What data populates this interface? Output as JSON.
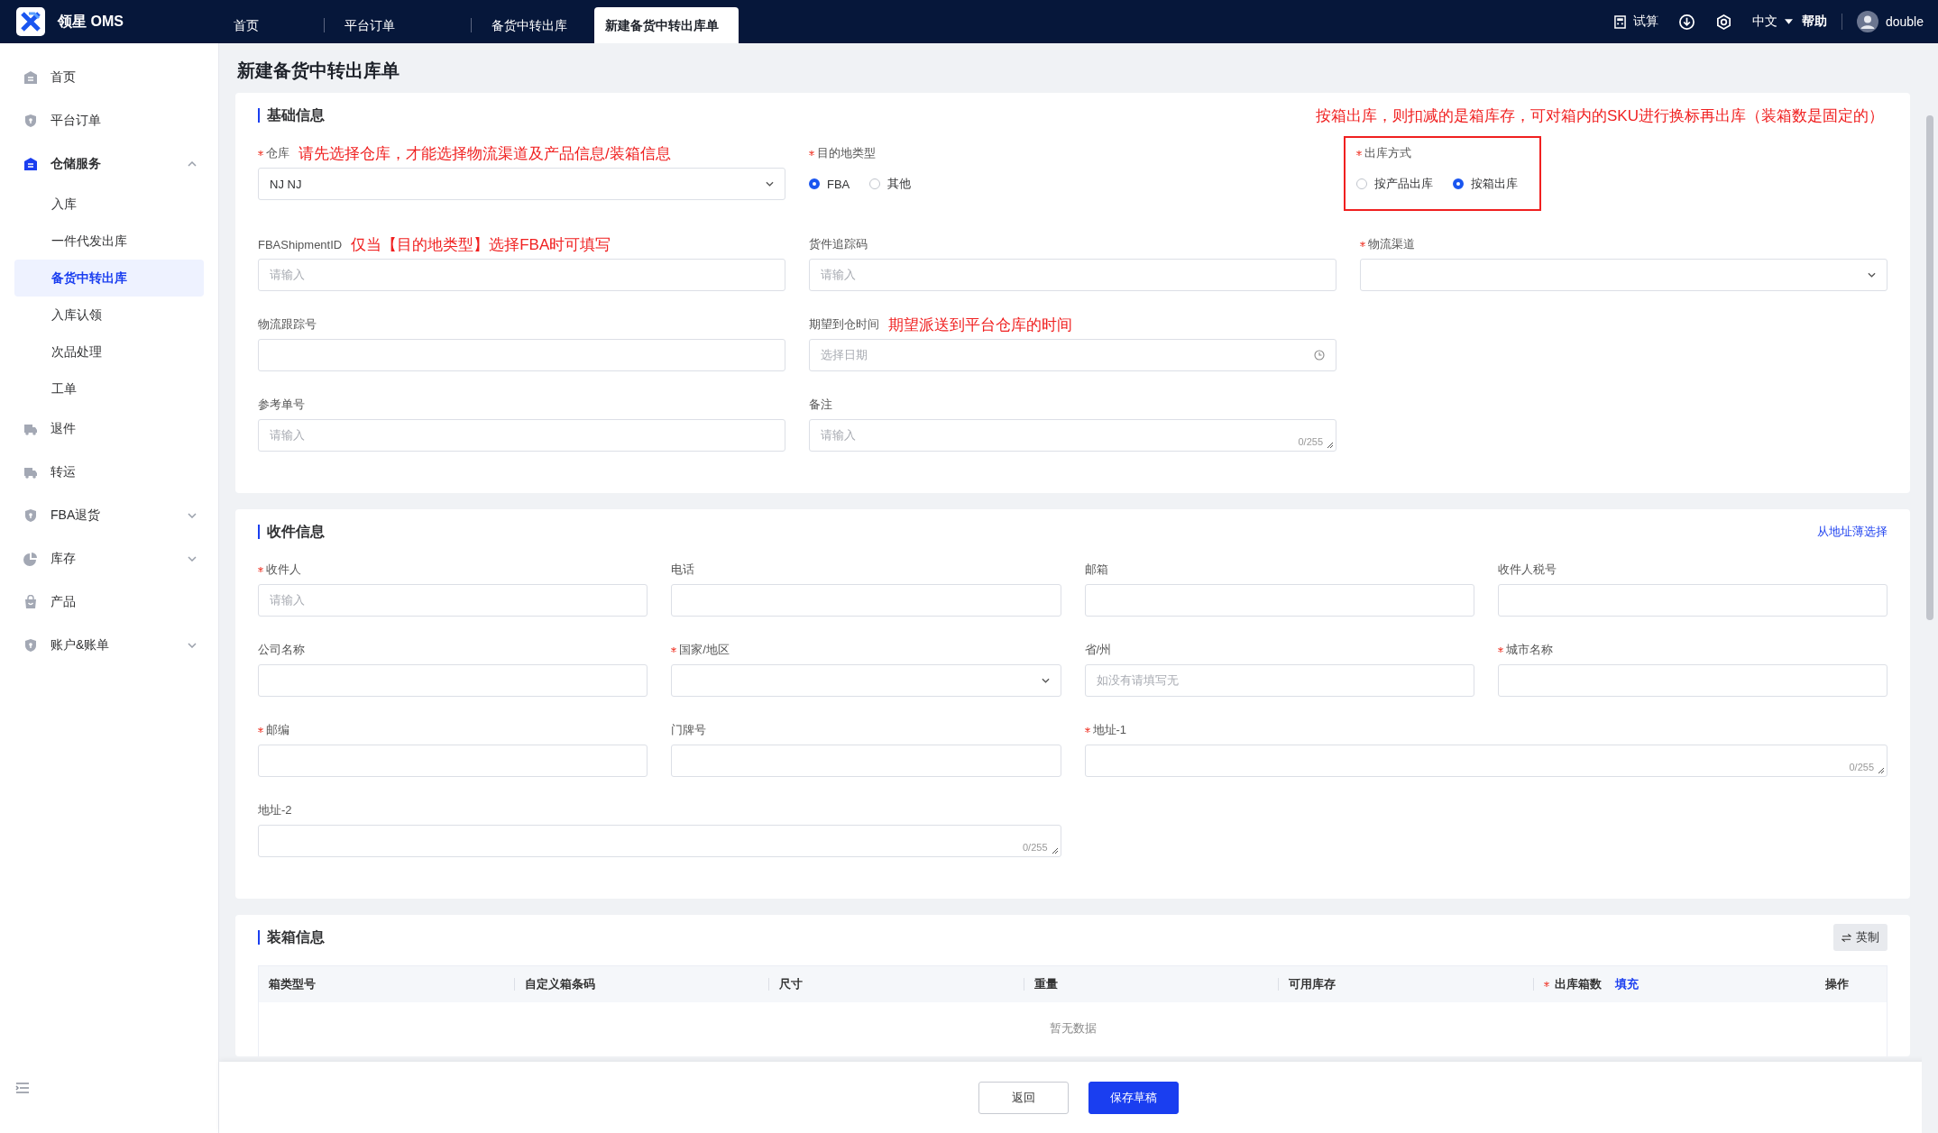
{
  "app": {
    "logo_text": "领星 OMS"
  },
  "tabs": [
    {
      "label": "首页",
      "selected": false
    },
    {
      "label": "平台订单",
      "selected": false
    },
    {
      "label": "备货中转出库",
      "selected": false
    },
    {
      "label": "新建备货中转出库单",
      "selected": true
    }
  ],
  "header_actions": {
    "calc": "试算",
    "language": "中文",
    "help": "帮助",
    "user": "double"
  },
  "sidebar": {
    "items": [
      {
        "label": "首页",
        "kind": "building",
        "selected": false
      },
      {
        "label": "平台订单",
        "kind": "shield",
        "selected": false
      },
      {
        "label": "仓储服务",
        "kind": "building",
        "selected": true,
        "expanded": true,
        "children": [
          {
            "label": "入库",
            "selected": false
          },
          {
            "label": "一件代发出库",
            "selected": false
          },
          {
            "label": "备货中转出库",
            "selected": true
          },
          {
            "label": "入库认领",
            "selected": false
          },
          {
            "label": "次品处理",
            "selected": false
          },
          {
            "label": "工单",
            "selected": false
          }
        ]
      },
      {
        "label": "退件",
        "kind": "truck",
        "selected": false
      },
      {
        "label": "转运",
        "kind": "truck",
        "selected": false
      },
      {
        "label": "FBA退货",
        "kind": "shield",
        "selected": false,
        "expanded": false
      },
      {
        "label": "库存",
        "kind": "pie",
        "selected": false,
        "expanded": false
      },
      {
        "label": "产品",
        "kind": "bag",
        "selected": false
      },
      {
        "label": "账户&账单",
        "kind": "shield",
        "selected": false,
        "expanded": false
      }
    ]
  },
  "page_title": "新建备货中转出库单",
  "sections": [
    {
      "title": "基础信息",
      "annotation": "按箱出库，则扣减的是箱库存，可对箱内的SKU进行换标再出库（装箱数是固定的）",
      "rows": [
        [
          {
            "label": "仓库",
            "required": true,
            "kind": "select",
            "value": "NJ NJ",
            "note": "请先选择仓库，才能选择物流渠道及产品信息/装箱信息",
            "highlighted": false
          },
          {
            "label": "目的地类型",
            "required": true,
            "kind": "radio",
            "highlighted": false,
            "options": [
              {
                "label": "FBA",
                "selected": true
              },
              {
                "label": "其他",
                "selected": false
              }
            ]
          },
          {
            "label": "出库方式",
            "required": true,
            "kind": "radio",
            "highlighted": true,
            "options": [
              {
                "label": "按产品出库",
                "selected": false
              },
              {
                "label": "按箱出库",
                "selected": true
              }
            ]
          }
        ],
        [
          {
            "label": "FBAShipmentID",
            "required": false,
            "kind": "input",
            "placeholder": "请输入",
            "note": "仅当【目的地类型】选择FBA时可填写",
            "highlighted": false
          },
          {
            "label": "货件追踪码",
            "required": false,
            "kind": "input",
            "placeholder": "请输入",
            "highlighted": false
          },
          {
            "label": "物流渠道",
            "required": true,
            "kind": "select",
            "highlighted": false
          }
        ],
        [
          {
            "label": "物流跟踪号",
            "required": false,
            "kind": "input",
            "highlighted": false
          },
          {
            "label": "期望到仓时间",
            "required": false,
            "kind": "date",
            "placeholder": "选择日期",
            "note": "期望派送到平台仓库的时间",
            "highlighted": false
          }
        ],
        [
          {
            "label": "参考单号",
            "required": false,
            "kind": "input",
            "placeholder": "请输入",
            "highlighted": false
          },
          {
            "label": "备注",
            "required": false,
            "kind": "textarea",
            "placeholder": "请输入",
            "counter": "0/255",
            "highlighted": false
          }
        ]
      ]
    },
    {
      "title": "收件信息",
      "link": "从地址薄选择",
      "rows": [
        [
          {
            "label": "收件人",
            "required": true,
            "kind": "input",
            "placeholder": "请输入",
            "highlighted": false
          },
          {
            "label": "电话",
            "required": false,
            "kind": "input",
            "highlighted": false
          },
          {
            "label": "邮箱",
            "required": false,
            "kind": "input",
            "highlighted": false
          },
          {
            "label": "收件人税号",
            "required": false,
            "kind": "input",
            "highlighted": false
          }
        ],
        [
          {
            "label": "公司名称",
            "required": false,
            "kind": "input",
            "highlighted": false
          },
          {
            "label": "国家/地区",
            "required": true,
            "kind": "select",
            "highlighted": false
          },
          {
            "label": "省/州",
            "required": false,
            "kind": "input",
            "placeholder": "如没有请填写无",
            "highlighted": false
          },
          {
            "label": "城市名称",
            "required": true,
            "kind": "input",
            "highlighted": false
          }
        ],
        [
          {
            "label": "邮编",
            "required": true,
            "kind": "input",
            "highlighted": false
          },
          {
            "label": "门牌号",
            "required": false,
            "kind": "input",
            "highlighted": false
          },
          {
            "label": "地址-1",
            "required": true,
            "kind": "textarea",
            "counter": "0/255",
            "highlighted": false
          }
        ],
        [
          {
            "label": "地址-2",
            "required": false,
            "kind": "textarea",
            "counter": "0/255",
            "highlighted": false
          }
        ]
      ]
    },
    {
      "title": "装箱信息",
      "button": "英制",
      "table": {
        "columns": [
          {
            "label": "箱类型号",
            "required": false
          },
          {
            "label": "自定义箱条码",
            "required": false
          },
          {
            "label": "尺寸",
            "required": false
          },
          {
            "label": "重量",
            "required": false
          },
          {
            "label": "可用库存",
            "required": false
          },
          {
            "label": "出库箱数",
            "required": true,
            "action": "填充"
          },
          {
            "label": "操作",
            "required": false
          }
        ],
        "empty": "暂无数据"
      }
    }
  ],
  "footer_buttons": [
    {
      "label": "返回",
      "kind": "default"
    },
    {
      "label": "保存草稿",
      "kind": "primary"
    }
  ]
}
